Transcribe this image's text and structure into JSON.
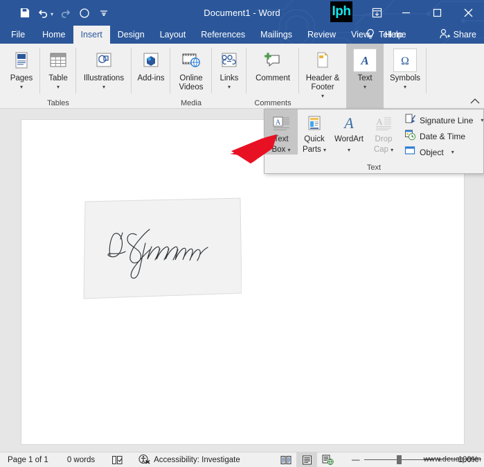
{
  "window": {
    "title": "Document1  -  Word",
    "badge_text": "Iph",
    "badge_color": "#12e8f0",
    "titlebar_color": "#2b579a",
    "quick_access": [
      {
        "name": "save",
        "icon": "save-icon",
        "label": "Save"
      },
      {
        "name": "undo",
        "icon": "undo-icon",
        "label": "Undo"
      },
      {
        "name": "redo",
        "icon": "redo-icon",
        "label": "Redo"
      },
      {
        "name": "mode",
        "icon": "circle-icon",
        "label": "Touch/Mouse Mode"
      },
      {
        "name": "customize",
        "icon": "customize-qat-icon",
        "label": "Customize Quick Access Toolbar"
      }
    ],
    "controls": [
      {
        "name": "ribbon-display-options",
        "glyph": "⤓",
        "label": "Ribbon Display Options"
      },
      {
        "name": "minimize",
        "glyph": "—",
        "label": "Minimize"
      },
      {
        "name": "restore",
        "glyph": "▫",
        "label": "Restore Down"
      },
      {
        "name": "close",
        "glyph": "✕",
        "label": "Close"
      }
    ]
  },
  "tabs": [
    {
      "label": "File",
      "active": false
    },
    {
      "label": "Home",
      "active": false
    },
    {
      "label": "Insert",
      "active": true
    },
    {
      "label": "Design",
      "active": false
    },
    {
      "label": "Layout",
      "active": false
    },
    {
      "label": "References",
      "active": false
    },
    {
      "label": "Mailings",
      "active": false
    },
    {
      "label": "Review",
      "active": false
    },
    {
      "label": "View",
      "active": false
    },
    {
      "label": "Help",
      "active": false
    }
  ],
  "tellme": {
    "label": "Tell me",
    "icon": "lightbulb-icon"
  },
  "share": {
    "label": "Share",
    "icon": "person-add-icon"
  },
  "ribbon": {
    "collapse_label": "⌃",
    "groups": [
      {
        "name": "pages",
        "label": "Pages",
        "caret": true,
        "icon": "cover-page-icon",
        "group_label": "",
        "selected": false,
        "sep": true
      },
      {
        "name": "table",
        "label": "Table",
        "caret": true,
        "icon": "table-icon",
        "group_label": "Tables",
        "selected": false,
        "sep": true
      },
      {
        "name": "illustrations",
        "label": "Illustrations",
        "caret": true,
        "icon": "shapes-icon",
        "group_label": "",
        "selected": false,
        "sep": true
      },
      {
        "name": "add-ins",
        "label": "Add-ins",
        "caret": true,
        "icon": "addins-icon",
        "group_label": "",
        "selected": false,
        "sep": true
      },
      {
        "name": "online-videos",
        "label": "Online Videos",
        "caret": false,
        "icon": "online-video-icon",
        "group_label": "Media",
        "selected": false,
        "sep": true
      },
      {
        "name": "links",
        "label": "Links",
        "caret": true,
        "icon": "link-icon",
        "group_label": "",
        "selected": false,
        "sep": true
      },
      {
        "name": "comment",
        "label": "Comment",
        "caret": false,
        "icon": "new-comment-icon",
        "group_label": "Comments",
        "selected": false,
        "sep": true
      },
      {
        "name": "header-footer",
        "label": "Header & Footer",
        "caret": true,
        "icon": "header-footer-icon",
        "group_label": "",
        "selected": false,
        "sep": false
      },
      {
        "name": "text",
        "label": "Text",
        "caret": true,
        "icon": "text-a-icon",
        "group_label": "",
        "selected": true,
        "sep": false
      },
      {
        "name": "symbols",
        "label": "Symbols",
        "caret": true,
        "icon": "omega-icon",
        "group_label": "",
        "selected": false,
        "sep": true
      }
    ]
  },
  "text_dropdown": {
    "group_label": "Text",
    "buttons": [
      {
        "name": "text-box",
        "line1": "Text",
        "line2": "Box",
        "caret": true,
        "icon": "text-box-icon",
        "selected": true,
        "disabled": false
      },
      {
        "name": "quick-parts",
        "line1": "Quick",
        "line2": "Parts",
        "caret": true,
        "icon": "quick-parts-icon",
        "selected": false,
        "disabled": false
      },
      {
        "name": "wordart",
        "line1": "WordArt",
        "line2": "",
        "caret": true,
        "icon": "wordart-icon",
        "selected": false,
        "disabled": false
      },
      {
        "name": "drop-cap",
        "line1": "Drop",
        "line2": "Cap",
        "caret": true,
        "icon": "drop-cap-icon",
        "selected": false,
        "disabled": true
      }
    ],
    "rows": [
      {
        "name": "signature-line",
        "label": "Signature Line",
        "caret": true,
        "icon": "signature-line-icon"
      },
      {
        "name": "date-time",
        "label": "Date & Time",
        "caret": false,
        "icon": "date-time-icon"
      },
      {
        "name": "object",
        "label": "Object",
        "caret": true,
        "icon": "object-icon"
      }
    ]
  },
  "annotation": {
    "arrow_color": "#e81123",
    "points_to": "text-box-button"
  },
  "document": {
    "signature_image_alt": "D. Sparrow handwritten signature scan"
  },
  "statusbar": {
    "page": "Page 1 of 1",
    "words": "0 words",
    "proofing_icon": "proofing-icon",
    "accessibility": "Accessibility: Investigate",
    "accessibility_icon": "accessibility-icon",
    "views": [
      {
        "name": "read-mode",
        "icon": "read-mode-icon",
        "active": false
      },
      {
        "name": "print-layout",
        "icon": "print-layout-icon",
        "active": true
      },
      {
        "name": "web-layout",
        "icon": "web-layout-icon",
        "active": false
      }
    ],
    "zoom_out": "—",
    "zoom_in": "+",
    "zoom_level": "100%",
    "watermark": "www.deuaq.com"
  }
}
